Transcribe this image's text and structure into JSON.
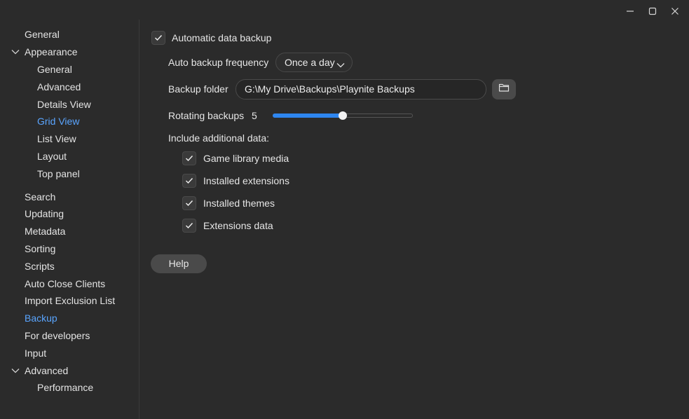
{
  "window": {
    "controls": [
      "minimize-icon",
      "maximize-icon",
      "close-icon"
    ]
  },
  "sidebar": {
    "general": "General",
    "appearance": {
      "label": "Appearance",
      "expanded": true,
      "children": [
        "General",
        "Advanced",
        "Details View",
        "Grid View",
        "List View",
        "Layout",
        "Top panel"
      ]
    },
    "items": [
      "Search",
      "Updating",
      "Metadata",
      "Sorting",
      "Scripts",
      "Auto Close Clients",
      "Import Exclusion List",
      "Backup",
      "For developers",
      "Input"
    ],
    "advanced": {
      "label": "Advanced",
      "expanded": true,
      "children": [
        "Performance"
      ]
    },
    "active_item": "Backup",
    "active_appearance_child": "Grid View"
  },
  "content": {
    "auto_backup": {
      "label": "Automatic data backup",
      "checked": true
    },
    "frequency": {
      "label": "Auto backup frequency",
      "value": "Once a day"
    },
    "folder": {
      "label": "Backup folder",
      "value": "G:\\My Drive\\Backups\\Playnite Backups"
    },
    "rotating": {
      "label": "Rotating backups",
      "value": "5",
      "fraction": 0.5
    },
    "include_label": "Include additional data:",
    "include": [
      {
        "label": "Game library media",
        "checked": true
      },
      {
        "label": "Installed extensions",
        "checked": true
      },
      {
        "label": "Installed themes",
        "checked": true
      },
      {
        "label": "Extensions data",
        "checked": true
      }
    ],
    "help_label": "Help"
  },
  "colors": {
    "background": "#2b2b2b",
    "accent": "#5aa5ff",
    "slider_fill": "#2e86f0"
  }
}
